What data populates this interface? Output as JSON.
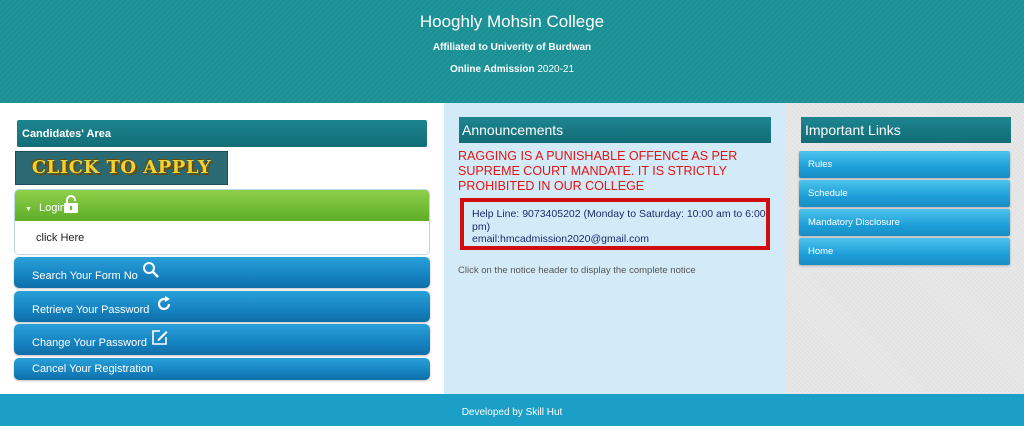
{
  "header": {
    "college_name": "Hooghly Mohsin College",
    "affiliation": "Affiliated to Univerity of Burdwan",
    "admission_label": "Online Admission",
    "admission_year": "2020-21"
  },
  "left": {
    "area_title": "Candidates' Area",
    "apply_banner": "CLICK TO APPLY ONLINE",
    "login_label": "Login",
    "login_link": "click Here",
    "buttons": {
      "search": "Search Your Form No",
      "retrieve": "Retrieve Your Password",
      "change": "Change Your Password",
      "cancel": "Cancel Your Registration"
    }
  },
  "announcements": {
    "title": "Announcements",
    "ragging_notice": "RAGGING IS A PUNISHABLE OFFENCE AS PER SUPREME COURT MANDATE. IT IS STRICTLY PROHIBITED IN OUR COLLEGE",
    "helpline": "Help Line: 9073405202 (Monday to Saturday: 10:00 am to 6:00 pm)",
    "email": "email:hmcadmission2020@gmail.com",
    "notice_hint": "Click on the notice header to display the complete notice"
  },
  "important_links": {
    "title": "Important Links",
    "items": [
      "Rules",
      "Schedule",
      "Mandatory Disclosure",
      "Home"
    ]
  },
  "footer": {
    "credit": "Developed by Skill Hut"
  },
  "colors": {
    "header_teal": "#1c8f94",
    "login_green": "#6cbf2f",
    "button_blue": "#1583c1",
    "link_blue": "#1d9fd9",
    "ragging_red": "#e01414",
    "footer_blue": "#1b9fc6"
  },
  "icons": [
    "lock-open-icon",
    "search-icon",
    "refresh-icon",
    "edit-icon"
  ]
}
